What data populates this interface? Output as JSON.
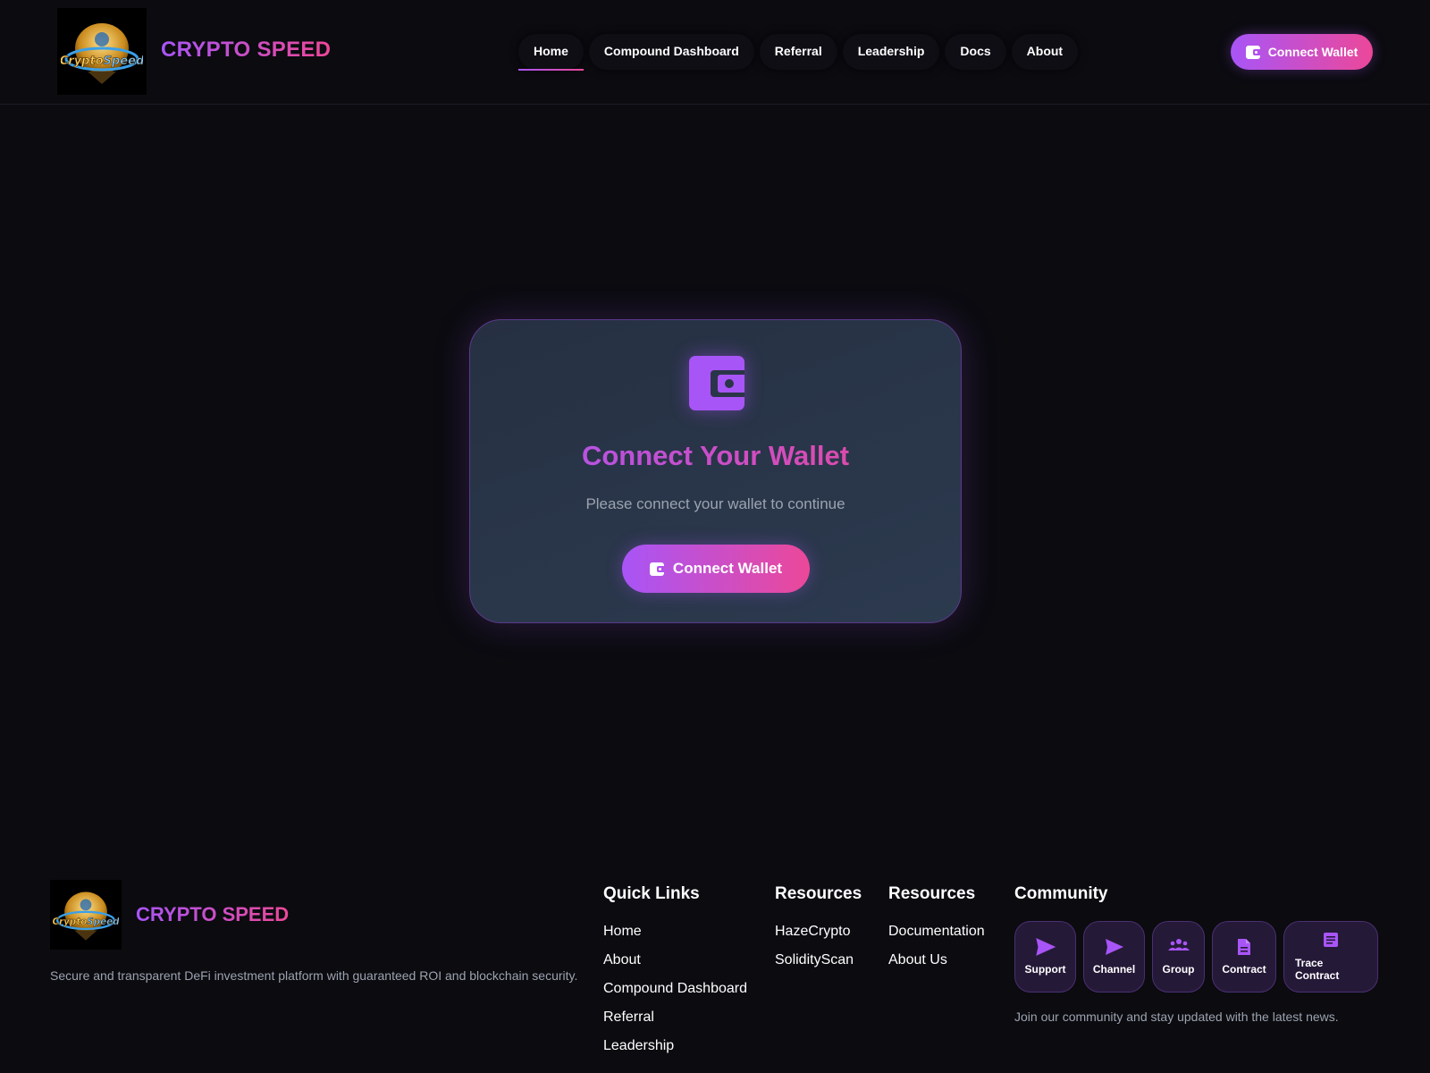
{
  "header": {
    "brand": "CRYPTO SPEED",
    "logo_text": "CryptoSpeed",
    "nav": [
      {
        "label": "Home",
        "active": true
      },
      {
        "label": "Compound Dashboard"
      },
      {
        "label": "Referral"
      },
      {
        "label": "Leadership"
      },
      {
        "label": "Docs"
      },
      {
        "label": "About"
      }
    ],
    "connect_label": "Connect Wallet"
  },
  "card": {
    "icon": "wallet-icon",
    "title": "Connect Your Wallet",
    "subtitle": "Please connect your wallet to continue",
    "button_label": "Connect Wallet"
  },
  "footer": {
    "brand": "CRYPTO SPEED",
    "description": "Secure and transparent DeFi investment platform with guaranteed ROI and blockchain security.",
    "quick_links": {
      "title": "Quick Links",
      "items": [
        "Home",
        "About",
        "Compound Dashboard",
        "Referral",
        "Leadership"
      ]
    },
    "resources1": {
      "title": "Resources",
      "items": [
        "HazeCrypto",
        "SolidityScan"
      ]
    },
    "resources2": {
      "title": "Resources",
      "items": [
        "Documentation",
        "About Us"
      ]
    },
    "community": {
      "title": "Community",
      "buttons": [
        {
          "label": "Support",
          "icon": "send-icon"
        },
        {
          "label": "Channel",
          "icon": "send-icon"
        },
        {
          "label": "Group",
          "icon": "group-icon"
        },
        {
          "label": "Contract",
          "icon": "document-icon"
        },
        {
          "label": "Trace Contract",
          "icon": "list-document-icon"
        }
      ],
      "note": "Join our community and stay updated with the latest news."
    }
  },
  "colors": {
    "background": "#0b0b10",
    "accent_start": "#a855f7",
    "accent_end": "#ec4899",
    "card_bg": "#2c3a4f"
  }
}
